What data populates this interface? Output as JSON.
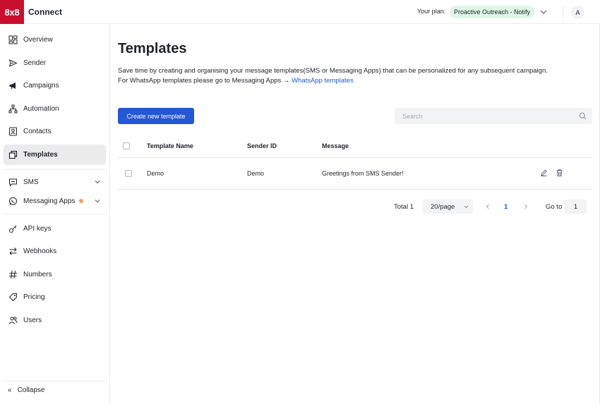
{
  "topbar": {
    "logo_text": "8x8",
    "brand": "Connect",
    "plan_label": "Your plan:",
    "plan_value": "Proactive Outreach - Notify",
    "avatar_initial": "A"
  },
  "sidebar": {
    "items": [
      {
        "label": "Overview",
        "icon": "overview-icon"
      },
      {
        "label": "Sender",
        "icon": "send-icon"
      },
      {
        "label": "Campaigns",
        "icon": "megaphone-icon"
      },
      {
        "label": "Automation",
        "icon": "flow-icon"
      },
      {
        "label": "Contacts",
        "icon": "contact-card-icon"
      },
      {
        "label": "Templates",
        "icon": "templates-icon",
        "active": true
      },
      {
        "label": "SMS",
        "icon": "chat-bubble-icon"
      },
      {
        "label": "Messaging Apps",
        "icon": "whatsapp-icon"
      },
      {
        "label": "API keys",
        "icon": "key-icon"
      },
      {
        "label": "Webhooks",
        "icon": "arrows-swap-icon"
      },
      {
        "label": "Numbers",
        "icon": "hash-icon"
      },
      {
        "label": "Pricing",
        "icon": "price-tag-icon"
      },
      {
        "label": "Users",
        "icon": "users-icon"
      }
    ],
    "collapse_label": "Collapse"
  },
  "main": {
    "title": "Templates",
    "description_line1": "Save time by creating and organising your message templates(SMS or Messaging Apps) that can be personalized for any subsequent campaign.",
    "description_line2": "For WhatsApp templates please go to Messaging Apps →",
    "whatsapp_link": "WhatsApp templates",
    "create_button": "Create new template",
    "search_placeholder": "Search"
  },
  "table": {
    "columns": [
      "Template Name",
      "Sender ID",
      "Message"
    ],
    "rows": [
      {
        "name": "Demo",
        "sender_id": "Demo",
        "message": "Greetings from SMS Sender!"
      }
    ]
  },
  "pagination": {
    "total": "Total 1",
    "page_size": "20/page",
    "current_page": "1",
    "goto_label": "Go to",
    "goto_value": "1"
  },
  "colors": {
    "brand_red": "#c8102e",
    "primary_blue": "#2457d6",
    "plan_pill_bg": "#dff5e8",
    "notification_dot": "#f5a15b"
  }
}
